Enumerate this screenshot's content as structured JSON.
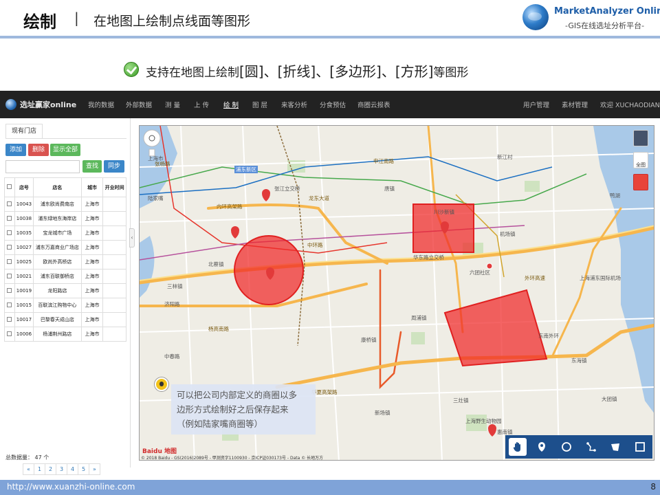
{
  "slide": {
    "title": "绘制",
    "separator": "|",
    "subtitle": "在地图上绘制点线面等图形",
    "logo_name": "MarketAnalyzer Online",
    "logo_tagline": "-GIS在线选址分析平台-",
    "feature_prefix": "支持在地图上绘制",
    "feature_shapes": "[圆]、[折线]、[多边形]、[方形]",
    "feature_suffix": "等图形",
    "footer_url": "http://www.xuanzhi-online.com",
    "page_number": "8"
  },
  "app": {
    "brand": "选址赢家online",
    "nav": [
      "我的数据",
      "外部数据",
      "测 量",
      "上 传",
      "绘 制",
      "图 层",
      "来客分析",
      "分食预估",
      "商圈云报表"
    ],
    "nav_active": "绘 制",
    "nav_right": [
      "用户管理",
      "素材管理",
      "欢迎 XUCHAODIAN!"
    ]
  },
  "sidebar": {
    "tab": "现有门店",
    "buttons": {
      "add": "添加",
      "delete": "删除",
      "show_all": "显示全部",
      "find": "查找",
      "sync": "同步"
    },
    "search_placeholder": "",
    "columns": [
      "",
      "店号",
      "店名",
      "城市",
      "开业时间"
    ],
    "rows": [
      [
        "10043",
        "浦东欧尚费南店",
        "上海市",
        ""
      ],
      [
        "10038",
        "浦东绿地东海岸店",
        "上海市",
        ""
      ],
      [
        "10035",
        "宝龙城市广场",
        "上海市",
        ""
      ],
      [
        "10027",
        "浦东万嘉商业广场店",
        "上海市",
        ""
      ],
      [
        "10025",
        "欧尚外高桥店",
        "上海市",
        ""
      ],
      [
        "10021",
        "浦东百联御桥店",
        "上海市",
        ""
      ],
      [
        "10019",
        "龙阳路店",
        "上海市",
        ""
      ],
      [
        "10015",
        "百联滨江购物中心",
        "上海市",
        ""
      ],
      [
        "10017",
        "巴黎春天成山店",
        "上海市",
        ""
      ],
      [
        "10006",
        "杨浦荆州路店",
        "上海市",
        ""
      ]
    ],
    "count_label": "总数据量： 47 个",
    "pages": [
      "«",
      "1",
      "2",
      "3",
      "4",
      "5",
      "»"
    ]
  },
  "map": {
    "callout": [
      "可以把公司内部定义的商圈以多",
      "边形方式绘制好之后保存起来",
      "（例如陆家嘴商圈等）"
    ],
    "controls": {
      "locate": "全图"
    },
    "baidu_logo": "Baidu 地图",
    "copyright": "© 2018 Baidu - GS(2016)2089号 - 甲测资字1100930 - 京ICP证030173号 - Data © 长地万方",
    "labels": {
      "shanghai": "上海市",
      "pudong": "浦东新区",
      "zhangjiang": "张江立交桥",
      "tangzhen": "唐镇",
      "chuanshajun": "川沙新镇",
      "jichang": "机场镇",
      "huadong": "华东路立交桥",
      "liuzao": "六团社区",
      "zhoupu": "周浦镇",
      "huinan": "惠南镇",
      "datuan": "大团镇",
      "donghai": "东海镇",
      "sanzao": "三灶镇",
      "xinchang": "新场镇",
      "kangqiao": "康桥镇",
      "beicai": "北蔡镇",
      "sanlin": "三林镇",
      "lujiazui": "陆家嘴",
      "road_zhonghuan": "中环路",
      "road_neihuan": "内环高架路",
      "road_yanggao": "杨高南路",
      "road_huaxia": "华夏高架路",
      "road_waihuan": "外环高速",
      "road_zhangyang": "张杨路",
      "road_longdong": "龙东大道",
      "road_shenjiang": "申江南路",
      "airport": "上海浦东国际机场",
      "yahu": "鸭湖",
      "hongqiao": "上海南站",
      "jijiang": "济阳路",
      "zhongchun": "中春路",
      "dongnan": "东南外环",
      "xinjiang": "新江村",
      "songjiang": "上海野生动物园"
    }
  }
}
